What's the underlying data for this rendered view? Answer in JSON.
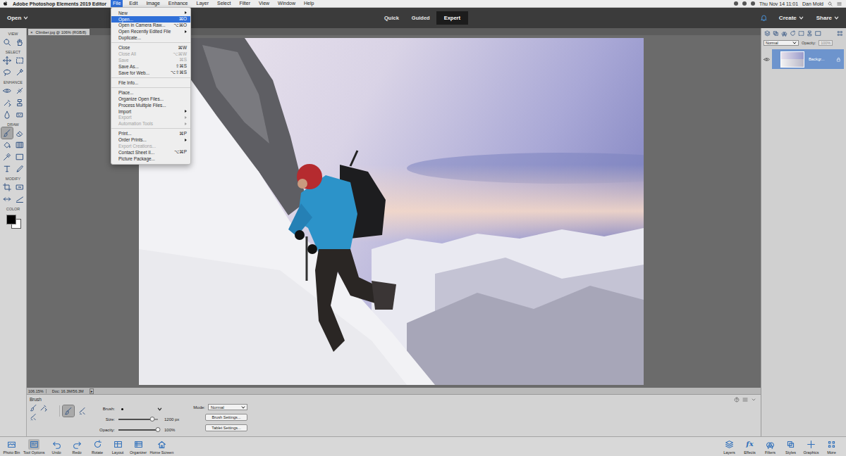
{
  "menubar": {
    "app_name": "Adobe Photoshop Elements 2019 Editor",
    "menus": [
      {
        "label": "File",
        "selected": true
      },
      {
        "label": "Edit",
        "selected": false
      },
      {
        "label": "Image",
        "selected": false
      },
      {
        "label": "Enhance",
        "selected": false
      },
      {
        "label": "Layer",
        "selected": false
      },
      {
        "label": "Select",
        "selected": false
      },
      {
        "label": "Filter",
        "selected": false
      },
      {
        "label": "View",
        "selected": false
      },
      {
        "label": "Window",
        "selected": false
      },
      {
        "label": "Help",
        "selected": false
      }
    ],
    "clock": "Thu Nov 14  11:01",
    "user": "Dan Mold"
  },
  "header": {
    "open": "Open",
    "modes": [
      {
        "label": "Quick",
        "selected": false
      },
      {
        "label": "Guided",
        "selected": false
      },
      {
        "label": "Expert",
        "selected": true
      }
    ],
    "create": "Create",
    "share": "Share"
  },
  "document_tab": {
    "close": "×",
    "title": "Climber.jpg @ 106% (RGB/8)"
  },
  "toolbox": {
    "sections": [
      {
        "label": "VIEW",
        "tools": [
          {
            "kind": "zoom",
            "selected": false
          },
          {
            "kind": "hand",
            "selected": false
          }
        ]
      },
      {
        "label": "SELECT",
        "tools": [
          {
            "kind": "move",
            "selected": false
          },
          {
            "kind": "marquee",
            "selected": false
          },
          {
            "kind": "lasso",
            "selected": false
          },
          {
            "kind": "quick-select",
            "selected": false
          }
        ]
      },
      {
        "label": "ENHANCE",
        "tools": [
          {
            "kind": "red-eye",
            "selected": false
          },
          {
            "kind": "spot-heal",
            "selected": false
          },
          {
            "kind": "smart-brush",
            "selected": false
          },
          {
            "kind": "clone",
            "selected": false
          },
          {
            "kind": "blur",
            "selected": false
          },
          {
            "kind": "sponge",
            "selected": false
          }
        ]
      },
      {
        "label": "DRAW",
        "tools": [
          {
            "kind": "brush",
            "selected": true
          },
          {
            "kind": "eraser",
            "selected": false
          },
          {
            "kind": "paint-bucket",
            "selected": false
          },
          {
            "kind": "gradient",
            "selected": false
          },
          {
            "kind": "eyedropper",
            "selected": false
          },
          {
            "kind": "shape",
            "selected": false
          },
          {
            "kind": "type",
            "selected": false
          },
          {
            "kind": "pencil",
            "selected": false
          }
        ]
      },
      {
        "label": "MODIFY",
        "tools": [
          {
            "kind": "crop",
            "selected": false
          },
          {
            "kind": "recompose",
            "selected": false
          },
          {
            "kind": "content-move",
            "selected": false
          },
          {
            "kind": "straighten",
            "selected": false
          }
        ]
      }
    ],
    "color": {
      "label": "COLOR",
      "foreground": "#000000",
      "background": "#ffffff"
    }
  },
  "status_bar": {
    "zoom": "106.15%",
    "doc_size": "Doc: 16.3M/56.3M",
    "arrow": "▸"
  },
  "tool_options": {
    "title": "Brush",
    "brush_types": [
      {
        "kind": "brush",
        "selected": true
      },
      {
        "kind": "impressionist",
        "selected": false
      }
    ],
    "brush_label": "Brush:",
    "size_label": "Size:",
    "size": {
      "level": 0.85,
      "reading": "1200 px"
    },
    "opacity_label": "Opacity:",
    "opacity": {
      "level": 1,
      "reading": "100%"
    },
    "mode_label": "Mode:",
    "mode": "Normal",
    "buttons": [
      "Brush Settings...",
      "Tablet Settings..."
    ]
  },
  "bottom_bar": {
    "left": [
      {
        "label": "Photo Bin",
        "kind": "photo-bin",
        "selected": false
      },
      {
        "label": "Tool Options",
        "kind": "tool-options",
        "selected": true
      },
      {
        "label": "Undo",
        "kind": "undo",
        "selected": false
      },
      {
        "label": "Redo",
        "kind": "redo",
        "selected": false
      },
      {
        "label": "Rotate",
        "kind": "rotate",
        "selected": false
      },
      {
        "label": "Layout",
        "kind": "layout",
        "selected": false
      },
      {
        "label": "Organizer",
        "kind": "organizer",
        "selected": false
      },
      {
        "label": "Home Screen",
        "kind": "home",
        "selected": false
      }
    ],
    "right": [
      {
        "label": "Layers",
        "kind": "layers",
        "selected": false
      },
      {
        "label": "Effects",
        "kind": "effects",
        "glyph": "fx",
        "selected": false
      },
      {
        "label": "Filters",
        "kind": "filters",
        "selected": false
      },
      {
        "label": "Styles",
        "kind": "styles",
        "selected": false
      },
      {
        "label": "Graphics",
        "kind": "graphics",
        "selected": false
      },
      {
        "label": "More",
        "kind": "more",
        "selected": false
      }
    ]
  },
  "layers_panel": {
    "blend_mode": "Normal",
    "opacity_label": "Opacity:",
    "opacity": "100%",
    "opacity_disabled": true,
    "layers": [
      {
        "name": "Backgr...",
        "selected": true,
        "visible": true,
        "locked": true
      }
    ]
  },
  "file_menu": {
    "items": [
      {
        "kind": "item",
        "label": "New",
        "shortcut": "",
        "submenu": true,
        "disabled": false,
        "selected": false
      },
      {
        "kind": "item",
        "label": "Open...",
        "shortcut": "⌘O",
        "submenu": false,
        "disabled": false,
        "selected": true
      },
      {
        "kind": "item",
        "label": "Open in Camera Raw...",
        "shortcut": "⌥⌘O",
        "submenu": false,
        "disabled": false,
        "selected": false
      },
      {
        "kind": "item",
        "label": "Open Recently Edited File",
        "shortcut": "",
        "submenu": true,
        "disabled": false,
        "selected": false
      },
      {
        "kind": "item",
        "label": "Duplicate...",
        "shortcut": "",
        "submenu": false,
        "disabled": false,
        "selected": false
      },
      {
        "kind": "separator"
      },
      {
        "kind": "item",
        "label": "Close",
        "shortcut": "⌘W",
        "submenu": false,
        "disabled": false,
        "selected": false
      },
      {
        "kind": "item",
        "label": "Close All",
        "shortcut": "⌥⌘W",
        "submenu": false,
        "disabled": true,
        "selected": false
      },
      {
        "kind": "item",
        "label": "Save",
        "shortcut": "⌘S",
        "submenu": false,
        "disabled": true,
        "selected": false
      },
      {
        "kind": "item",
        "label": "Save As...",
        "shortcut": "⇧⌘S",
        "submenu": false,
        "disabled": false,
        "selected": false
      },
      {
        "kind": "item",
        "label": "Save for Web...",
        "shortcut": "⌥⇧⌘S",
        "submenu": false,
        "disabled": false,
        "selected": false
      },
      {
        "kind": "separator"
      },
      {
        "kind": "item",
        "label": "File Info...",
        "shortcut": "",
        "submenu": false,
        "disabled": false,
        "selected": false
      },
      {
        "kind": "separator"
      },
      {
        "kind": "item",
        "label": "Place...",
        "shortcut": "",
        "submenu": false,
        "disabled": false,
        "selected": false
      },
      {
        "kind": "item",
        "label": "Organize Open Files...",
        "shortcut": "",
        "submenu": false,
        "disabled": false,
        "selected": false
      },
      {
        "kind": "item",
        "label": "Process Multiple Files...",
        "shortcut": "",
        "submenu": false,
        "disabled": false,
        "selected": false
      },
      {
        "kind": "item",
        "label": "Import",
        "shortcut": "",
        "submenu": true,
        "disabled": false,
        "selected": false
      },
      {
        "kind": "item",
        "label": "Export",
        "shortcut": "",
        "submenu": true,
        "disabled": true,
        "selected": false
      },
      {
        "kind": "item",
        "label": "Automation Tools",
        "shortcut": "",
        "submenu": true,
        "disabled": true,
        "selected": false
      },
      {
        "kind": "separator"
      },
      {
        "kind": "item",
        "label": "Print...",
        "shortcut": "⌘P",
        "submenu": false,
        "disabled": false,
        "selected": false
      },
      {
        "kind": "item",
        "label": "Order Prints...",
        "shortcut": "",
        "submenu": true,
        "disabled": false,
        "selected": false
      },
      {
        "kind": "item",
        "label": "Export Creations...",
        "shortcut": "",
        "submenu": false,
        "disabled": true,
        "selected": false
      },
      {
        "kind": "item",
        "label": "Contact Sheet II...",
        "shortcut": "⌥⌘P",
        "submenu": false,
        "disabled": false,
        "selected": false
      },
      {
        "kind": "item",
        "label": "Picture Package...",
        "shortcut": "",
        "submenu": false,
        "disabled": false,
        "selected": false
      }
    ]
  }
}
